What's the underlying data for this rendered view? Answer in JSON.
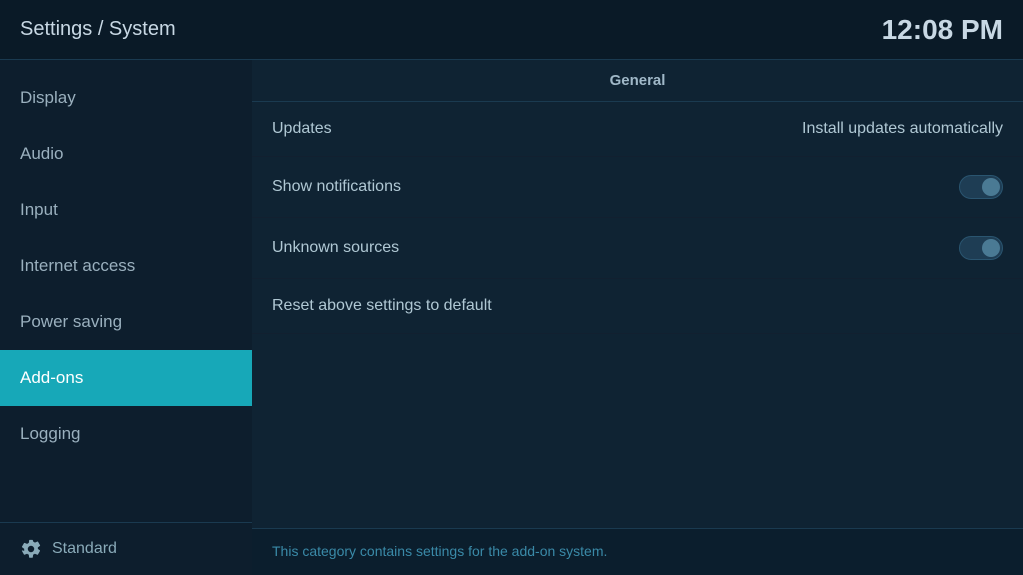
{
  "header": {
    "title": "Settings / System",
    "time": "12:08 PM"
  },
  "sidebar": {
    "items": [
      {
        "id": "display",
        "label": "Display",
        "active": false
      },
      {
        "id": "audio",
        "label": "Audio",
        "active": false
      },
      {
        "id": "input",
        "label": "Input",
        "active": false
      },
      {
        "id": "internet-access",
        "label": "Internet access",
        "active": false
      },
      {
        "id": "power-saving",
        "label": "Power saving",
        "active": false
      },
      {
        "id": "add-ons",
        "label": "Add-ons",
        "active": true
      },
      {
        "id": "logging",
        "label": "Logging",
        "active": false
      }
    ],
    "bottom_label": "Standard"
  },
  "content": {
    "section_header": "General",
    "rows": [
      {
        "id": "updates",
        "label": "Updates",
        "value": "Install updates automatically",
        "type": "value"
      },
      {
        "id": "show-notifications",
        "label": "Show notifications",
        "value": null,
        "type": "toggle",
        "toggle_state": "off"
      },
      {
        "id": "unknown-sources",
        "label": "Unknown sources",
        "value": null,
        "type": "toggle",
        "toggle_state": "off"
      },
      {
        "id": "reset",
        "label": "Reset above settings to default",
        "value": null,
        "type": "reset"
      }
    ],
    "footer_note": "This category contains settings for the add-on system."
  },
  "icons": {
    "gear": "⚙"
  }
}
